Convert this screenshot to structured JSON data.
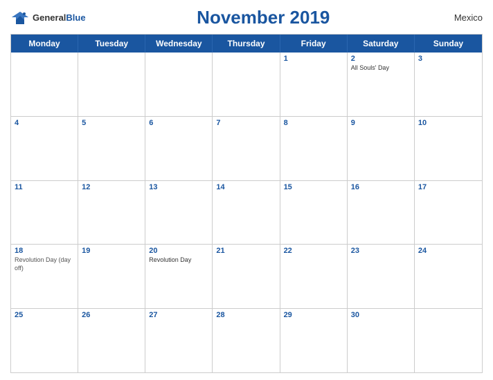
{
  "header": {
    "logo_general": "General",
    "logo_blue": "Blue",
    "title": "November 2019",
    "country": "Mexico"
  },
  "days_of_week": [
    "Monday",
    "Tuesday",
    "Wednesday",
    "Thursday",
    "Friday",
    "Saturday",
    "Sunday"
  ],
  "weeks": [
    [
      {
        "num": "",
        "events": []
      },
      {
        "num": "",
        "events": []
      },
      {
        "num": "",
        "events": []
      },
      {
        "num": "",
        "events": []
      },
      {
        "num": "1",
        "events": []
      },
      {
        "num": "2",
        "events": [
          {
            "text": "All Souls' Day",
            "day_off": false
          }
        ]
      },
      {
        "num": "3",
        "events": []
      }
    ],
    [
      {
        "num": "4",
        "events": []
      },
      {
        "num": "5",
        "events": []
      },
      {
        "num": "6",
        "events": []
      },
      {
        "num": "7",
        "events": []
      },
      {
        "num": "8",
        "events": []
      },
      {
        "num": "9",
        "events": []
      },
      {
        "num": "10",
        "events": []
      }
    ],
    [
      {
        "num": "11",
        "events": []
      },
      {
        "num": "12",
        "events": []
      },
      {
        "num": "13",
        "events": []
      },
      {
        "num": "14",
        "events": []
      },
      {
        "num": "15",
        "events": []
      },
      {
        "num": "16",
        "events": []
      },
      {
        "num": "17",
        "events": []
      }
    ],
    [
      {
        "num": "18",
        "events": [
          {
            "text": "Revolution Day (day off)",
            "day_off": true
          }
        ]
      },
      {
        "num": "19",
        "events": []
      },
      {
        "num": "20",
        "events": [
          {
            "text": "Revolution Day",
            "day_off": false
          }
        ]
      },
      {
        "num": "21",
        "events": []
      },
      {
        "num": "22",
        "events": []
      },
      {
        "num": "23",
        "events": []
      },
      {
        "num": "24",
        "events": []
      }
    ],
    [
      {
        "num": "25",
        "events": []
      },
      {
        "num": "26",
        "events": []
      },
      {
        "num": "27",
        "events": []
      },
      {
        "num": "28",
        "events": []
      },
      {
        "num": "29",
        "events": []
      },
      {
        "num": "30",
        "events": []
      },
      {
        "num": "",
        "events": []
      }
    ]
  ]
}
